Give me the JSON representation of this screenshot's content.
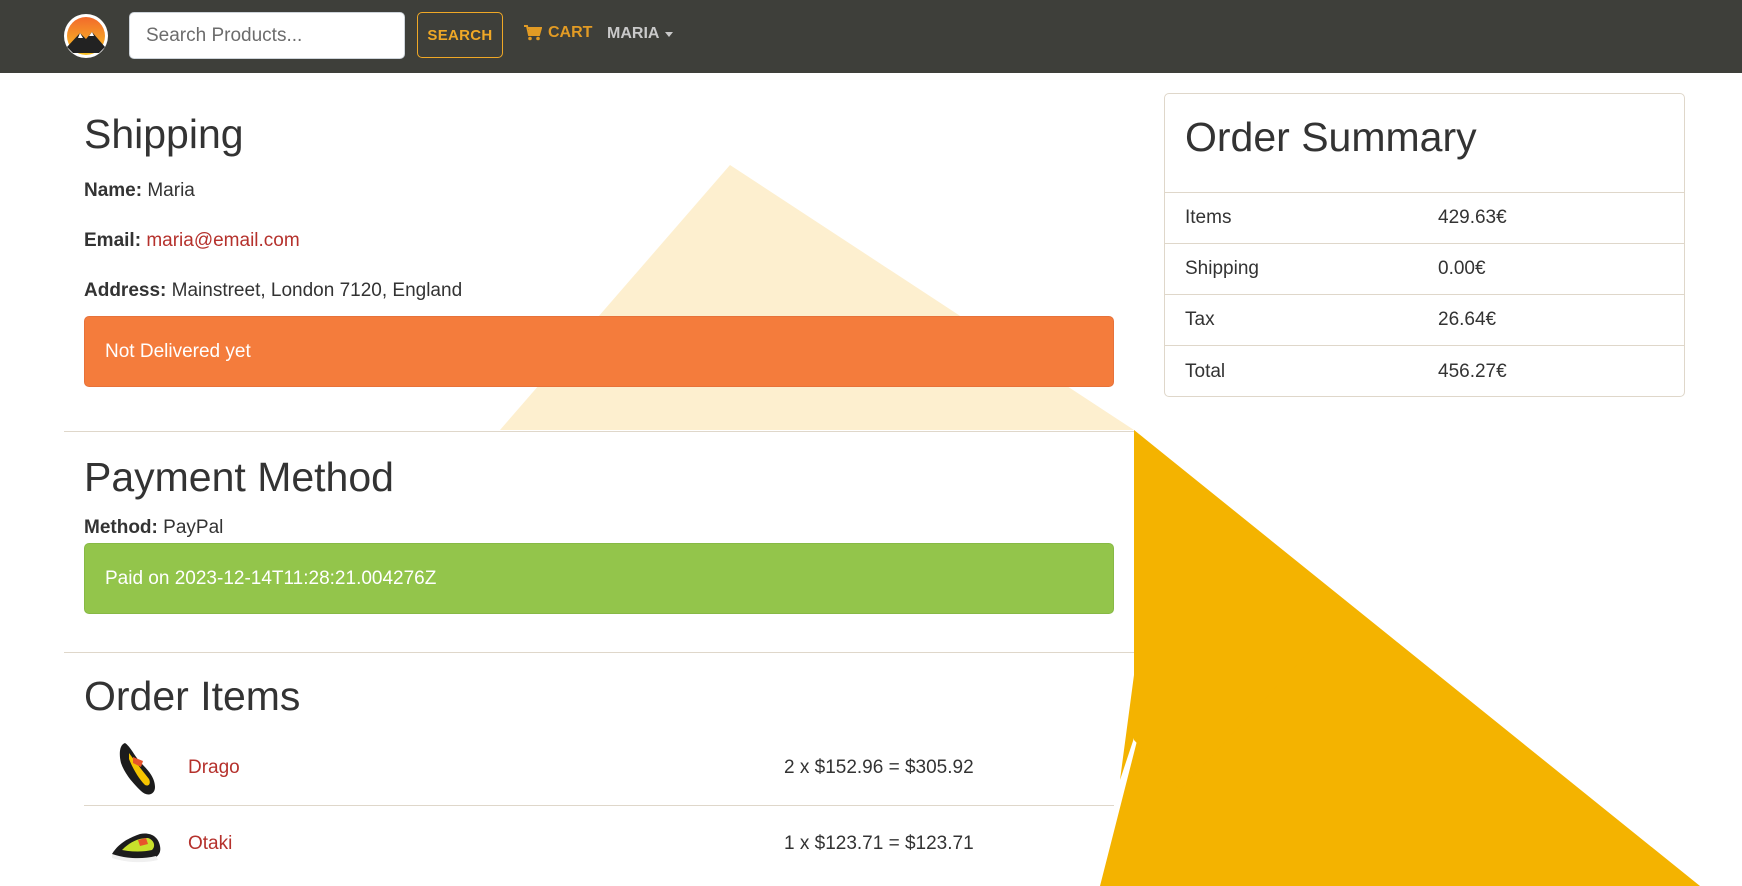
{
  "nav": {
    "search_placeholder": "Search Products...",
    "search_label": "SEARCH",
    "cart_label": "CART",
    "user_label": "MARIA"
  },
  "shipping": {
    "title": "Shipping",
    "name_label": "Name:",
    "name_value": "Maria",
    "email_label": "Email:",
    "email_value": "maria@email.com",
    "address_label": "Address:",
    "address_value": "Mainstreet, London 7120, England",
    "status": "Not Delivered yet"
  },
  "payment": {
    "title": "Payment Method",
    "method_label": "Method:",
    "method_value": "PayPal",
    "status": "Paid on 2023-12-14T11:28:21.004276Z"
  },
  "order_items": {
    "title": "Order Items",
    "items": [
      {
        "name": "Drago",
        "price_line": "2 x $152.96 = $305.92",
        "image": "climbing-shoe-yellow-black"
      },
      {
        "name": "Otaki",
        "price_line": "1 x $123.71 = $123.71",
        "image": "climbing-shoe-lime-black"
      }
    ]
  },
  "summary": {
    "title": "Order Summary",
    "rows": [
      {
        "label": "Items",
        "value": "429.63€"
      },
      {
        "label": "Shipping",
        "value": "0.00€"
      },
      {
        "label": "Tax",
        "value": "26.64€"
      },
      {
        "label": "Total",
        "value": "456.27€"
      }
    ]
  },
  "colors": {
    "navbar": "#3e3f3a",
    "accent": "#f0a826",
    "warning": "#f47c3c",
    "success": "#93c54b",
    "link": "#b5312c"
  }
}
